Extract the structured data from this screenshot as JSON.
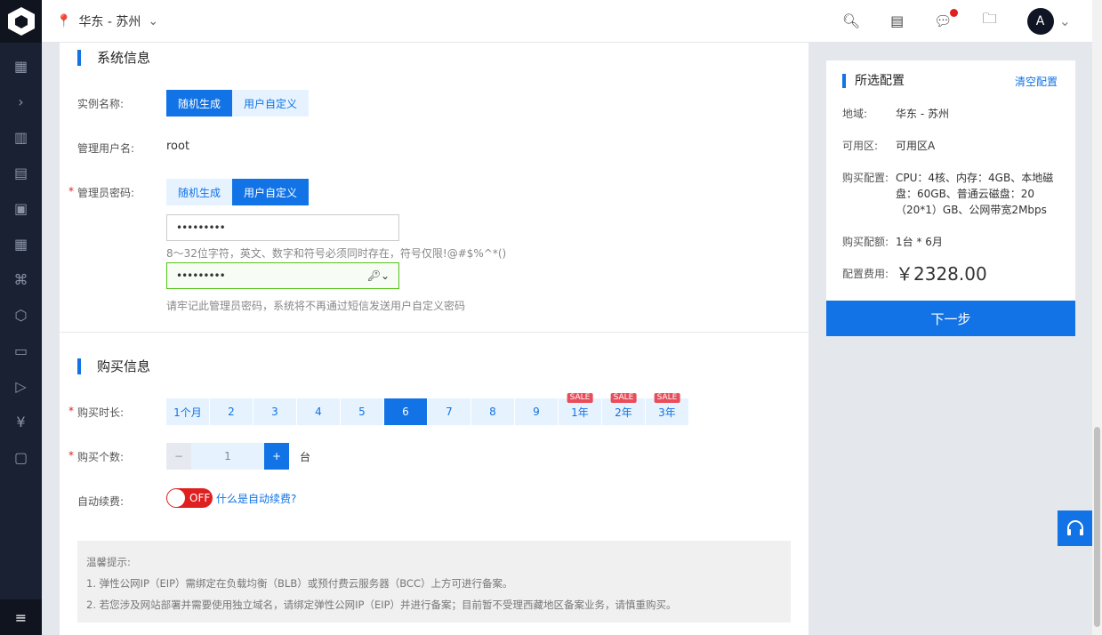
{
  "topbar": {
    "region": "华东 - 苏州",
    "avatar": "A"
  },
  "system": {
    "title": "系统信息",
    "instance_name_label": "实例名称:",
    "instance_opts": [
      "随机生成",
      "用户自定义"
    ],
    "admin_user_label": "管理用户名:",
    "admin_user": "root",
    "password_label": "管理员密码:",
    "password_opts": [
      "随机生成",
      "用户自定义"
    ],
    "password_value": "•••••••••",
    "password_hint": "8～32位字符，英文、数字和符号必须同时存在，符号仅限!@#$%^*()",
    "confirm_value": "•••••••••",
    "confirm_hint": "请牢记此管理员密码，系统将不再通过短信发送用户自定义密码"
  },
  "purchase": {
    "title": "购买信息",
    "duration_label": "购买时长:",
    "durations": [
      {
        "label": "1个月"
      },
      {
        "label": "2"
      },
      {
        "label": "3"
      },
      {
        "label": "4"
      },
      {
        "label": "5"
      },
      {
        "label": "6",
        "selected": true
      },
      {
        "label": "7"
      },
      {
        "label": "8"
      },
      {
        "label": "9"
      },
      {
        "label": "1年",
        "sale": "SALE"
      },
      {
        "label": "2年",
        "sale": "SALE"
      },
      {
        "label": "3年",
        "sale": "SALE"
      }
    ],
    "count_label": "购买个数:",
    "minus": "−",
    "count": "1",
    "plus": "+",
    "unit": "台",
    "renew_label": "自动续费:",
    "renew_toggle": "OFF",
    "renew_link": "什么是自动续费?"
  },
  "tips": {
    "title": "温馨提示:",
    "lines": [
      "1. 弹性公网IP（EIP）需绑定在负载均衡（BLB）或预付费云服务器（BCC）上方可进行备案。",
      "2. 若您涉及网站部署并需要使用独立域名，请绑定弹性公网IP（EIP）并进行备案；目前暂不受理西藏地区备案业务，请慎重购买。"
    ]
  },
  "summary": {
    "title": "所选配置",
    "clear": "清空配置",
    "region_k": "地域:",
    "region_v": "华东 - 苏州",
    "zone_k": "可用区:",
    "zone_v": "可用区A",
    "config_k": "购买配置:",
    "config_v": "CPU：4核、内存：4GB、本地磁盘：60GB、普通云磁盘：20（20*1）GB、公网带宽2Mbps",
    "quota_k": "购买配额:",
    "quota_v": "1台 * 6月",
    "fee_k": "配置费用:",
    "fee_v": "￥2328.00",
    "next": "下一步"
  }
}
